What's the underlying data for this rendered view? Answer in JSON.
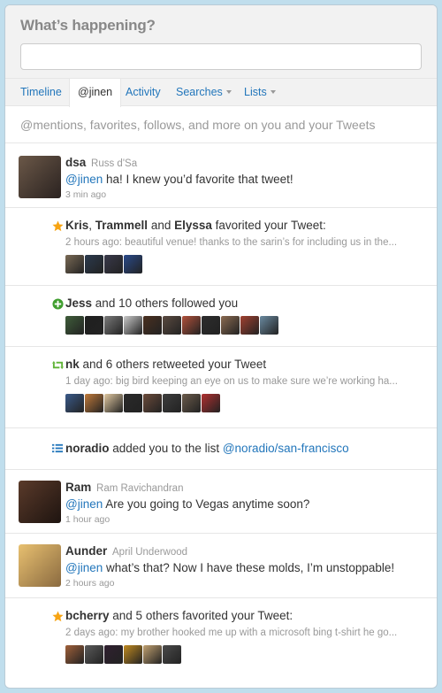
{
  "composer": {
    "title": "What’s happening?"
  },
  "tabs": [
    {
      "label": "Timeline"
    },
    {
      "label": "@jinen"
    },
    {
      "label": "Activity"
    },
    {
      "label": "Searches"
    },
    {
      "label": "Lists"
    }
  ],
  "description": "@mentions, favorites, follows, and more on you and your Tweets",
  "items": [
    {
      "screen_name": "dsa",
      "full_name": "Russ d'Sa",
      "mention": "@jinen",
      "text": " ha! I knew you’d favorite that tweet!",
      "time": "3 min ago"
    },
    {
      "names": [
        "Kris",
        "Trammell",
        "Elyssa"
      ],
      "sep1": ", ",
      "sep2": " and ",
      "action": " favorited your Tweet:",
      "sub": "2 hours ago: beautiful venue! thanks to the sarin’s for including us in the..."
    },
    {
      "name": "Jess",
      "action": " and 10 others followed you"
    },
    {
      "name": "nk",
      "action": " and 6 others retweeted your Tweet",
      "sub": "1 day ago: big bird keeping an eye on us to make sure we’re working ha..."
    },
    {
      "name": "noradio",
      "action": " added you to the list ",
      "list": "@noradio/san-francisco"
    },
    {
      "screen_name": "Ram",
      "full_name": "Ram Ravichandran",
      "mention": "@jinen",
      "text": " Are you going to Vegas anytime soon?",
      "time": "1 hour ago"
    },
    {
      "screen_name": "Aunder",
      "full_name": "April Underwood",
      "mention": "@jinen",
      "text": " what’s that? Now I have these molds, I’m unstoppable!",
      "time": "2 hours ago"
    },
    {
      "name": "bcherry",
      "action": " and 5 others favorited your Tweet:",
      "sub": "2 days ago: my brother hooked me up with a microsoft bing t-shirt he go..."
    }
  ],
  "colors": {
    "link": "#2276bb",
    "star": "#f7a413",
    "follow": "#3f9e2e",
    "retweet": "#5fb336",
    "list": "#2276bb",
    "thumbs_fav1": [
      "#7a6a55",
      "#2b3a4d",
      "#39394a",
      "#2a4a8a"
    ],
    "thumbs_follow": [
      "#3f5d3a",
      "#1f1f1f",
      "#7a7a7a",
      "#c9c9c9",
      "#4a3020",
      "#5a4a40",
      "#b0503a",
      "#2d2d2d",
      "#8a6a50",
      "#a04030",
      "#6a8aa0"
    ],
    "thumbs_rt": [
      "#3a5a8a",
      "#c07a3a",
      "#e0c8a0",
      "#2a2a2a",
      "#6a4a3a",
      "#3d3d3d",
      "#6a5a4a",
      "#b03030"
    ],
    "thumbs_fav2": [
      "#a0603a",
      "#5a5a5a",
      "#302030",
      "#c08a20",
      "#c0a070",
      "#4a4a4a"
    ]
  }
}
